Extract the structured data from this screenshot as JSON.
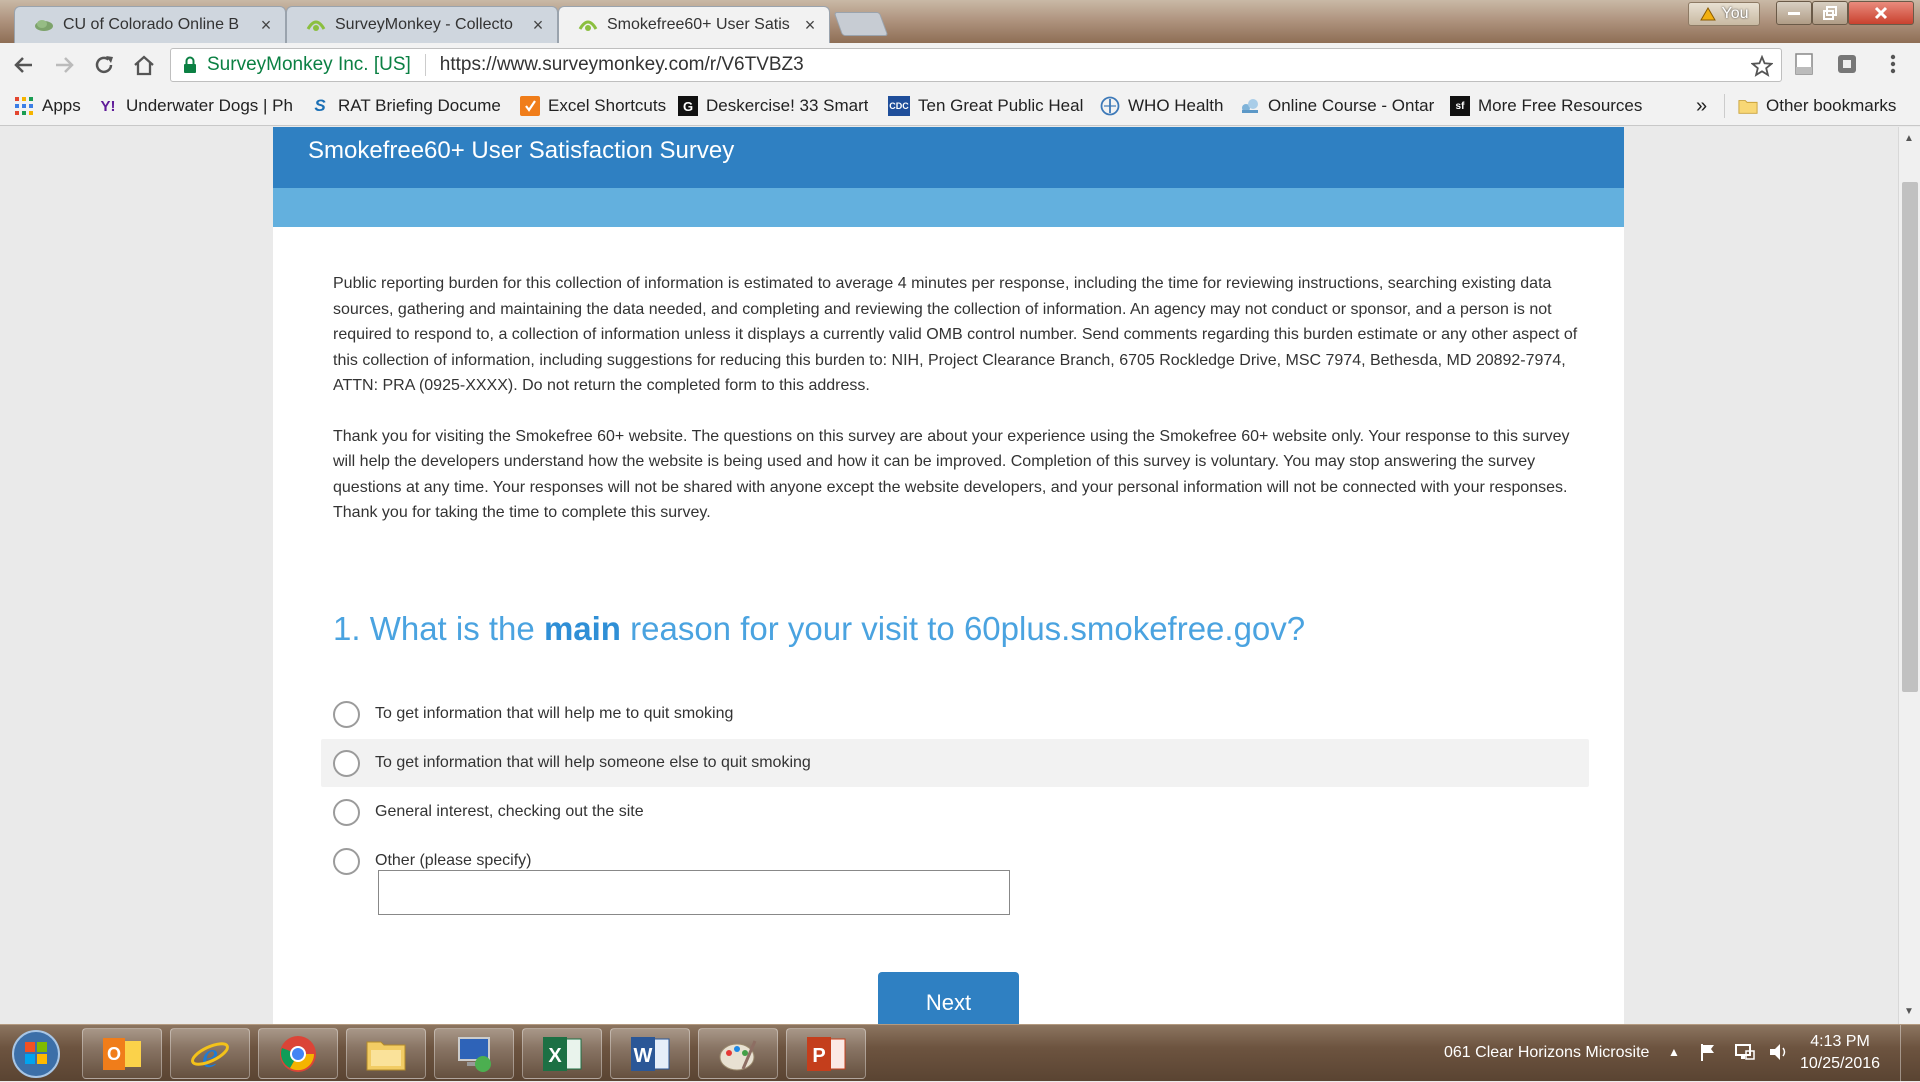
{
  "browser": {
    "tabs": [
      {
        "title": "CU of Colorado Online B",
        "icon": "cloud-favicon",
        "active": false
      },
      {
        "title": "SurveyMonkey - Collecto",
        "icon": "surveymonkey-favicon",
        "active": false
      },
      {
        "title": "Smokefree60+ User Satis",
        "icon": "surveymonkey-favicon",
        "active": true
      }
    ],
    "close_glyph": "×",
    "window_user": "You",
    "address": {
      "site_identity": "SurveyMonkey Inc. [US]",
      "url": "https://www.surveymonkey.com/r/V6TVBZ3"
    },
    "bookmarks": [
      {
        "label": "Apps",
        "icon": "apps-grid-icon"
      },
      {
        "label": "Underwater Dogs | Ph",
        "icon": "yahoo-icon"
      },
      {
        "label": "RAT Briefing Documer",
        "icon": "scribd-icon"
      },
      {
        "label": "Excel Shortcuts",
        "icon": "bookmark-orange-icon"
      },
      {
        "label": "Deskercise! 33 Smart",
        "icon": "bookmark-g-icon"
      },
      {
        "label": "Ten Great Public Heal",
        "icon": "cdc-icon"
      },
      {
        "label": "WHO Health",
        "icon": "who-icon"
      },
      {
        "label": "Online Course - Ontar",
        "icon": "bookmark-blue-icon"
      },
      {
        "label": "More Free Resources",
        "icon": "sf-icon"
      }
    ],
    "overflow_glyph": "»",
    "other_bookmarks": "Other bookmarks"
  },
  "survey": {
    "title": "Smokefree60+ User Satisfaction Survey",
    "intro_paragraphs": [
      "Public reporting burden for this collection of information is estimated to average 4 minutes per response, including the time for reviewing instructions, searching existing data sources, gathering and maintaining the data needed, and completing and reviewing the collection of information. An agency may not conduct or sponsor, and a person is not required to respond to, a collection of information unless it displays a currently valid OMB control number. Send comments regarding this burden estimate or any other aspect of this collection of information, including suggestions for reducing this burden to: NIH, Project Clearance Branch, 6705 Rockledge Drive, MSC 7974, Bethesda, MD 20892-7974, ATTN: PRA (0925-XXXX). Do not return the completed form to this address.",
      "Thank you for visiting the Smokefree 60+ website. The questions on this survey are about your experience using the Smokefree 60+ website only. Your response to this survey will help the developers understand how the website is being used and how it can be improved. Completion of this survey is voluntary. You may stop answering the survey questions at any time. Your responses will not be shared with anyone except the website developers, and your personal information will not be connected with your responses. Thank you for taking the time to complete this survey."
    ],
    "question": {
      "prefix": "1. What is the ",
      "emphasis": "main",
      "suffix": " reason for your visit to 60plus.smokefree.gov?"
    },
    "options": [
      "To get information that will help me to quit smoking",
      "To get information that will help someone else to quit smoking",
      "General interest, checking out the site",
      "Other (please specify)"
    ],
    "other_value": "",
    "next_label": "Next"
  },
  "taskbar": {
    "apps": [
      "outlook-icon",
      "internet-explorer-icon",
      "chrome-icon",
      "file-explorer-icon",
      "remote-desktop-icon",
      "excel-icon",
      "word-icon",
      "paint-icon",
      "powerpoint-icon"
    ],
    "tray_label": "061 Clear Horizons Microsite",
    "clock_time": "4:13 PM",
    "clock_date": "10/25/2016"
  },
  "colors": {
    "survey_header": "#2f80c2",
    "survey_subbar": "#63b0de",
    "question_text": "#4aa3e0",
    "secure_green": "#0b8043"
  }
}
